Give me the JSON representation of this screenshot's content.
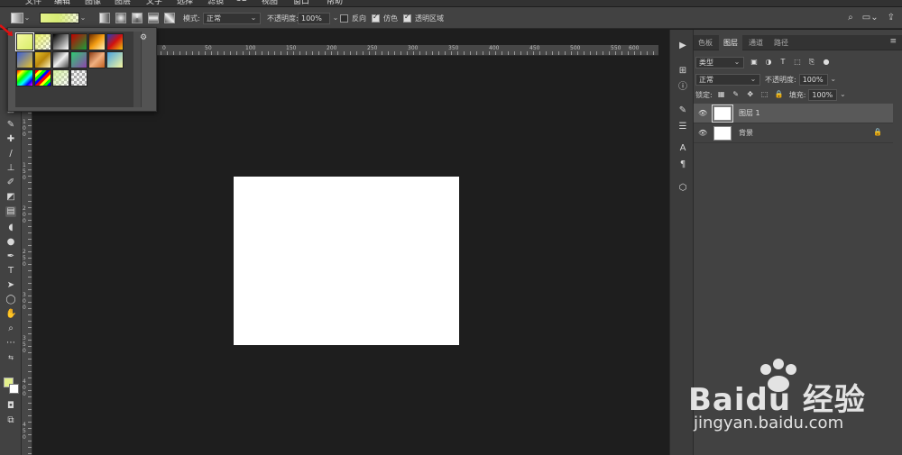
{
  "menubar": {
    "items": [
      "文件",
      "编辑",
      "图像",
      "图层",
      "文字",
      "选择",
      "滤镜",
      "3D",
      "视图",
      "窗口",
      "帮助"
    ]
  },
  "options": {
    "mode_label": "模式:",
    "mode_value": "正常",
    "opacity_label": "不透明度:",
    "opacity_value": "100%",
    "reverse_label": "反向",
    "dither_label": "仿色",
    "transparency_label": "透明区域"
  },
  "gradient_presets": [
    "#f0f58a",
    "#e8f060",
    "#000000",
    "#c00000",
    "#f39c12",
    "#1f3fbf",
    "#3a5fd9",
    "#e7c22a",
    "#c0c0c0",
    "#2ecc71",
    "#c06020",
    "#4aa3df",
    "#ff0000",
    "#e83e8c",
    "#d4f0a0",
    "#f2f2f2"
  ],
  "ruler": {
    "top_labels": [
      "0",
      "50",
      "100",
      "150",
      "200",
      "250",
      "300",
      "350",
      "400",
      "450",
      "500",
      "550",
      "600",
      "650",
      "700",
      "750"
    ],
    "left_labels": [
      "1",
      "0",
      "0",
      "1",
      "5",
      "0",
      "2",
      "0",
      "0",
      "2",
      "5",
      "0",
      "3",
      "0",
      "0",
      "3",
      "5",
      "0",
      "4",
      "0",
      "0",
      "4",
      "5",
      "0"
    ]
  },
  "panel": {
    "tabs": [
      "色板",
      "图层",
      "通道",
      "路径"
    ],
    "filter_label": "类型",
    "blend_mode": "正常",
    "opacity_label": "不透明度:",
    "opacity_value": "100%",
    "lock_label": "锁定:",
    "fill_label": "填充:",
    "fill_value": "100%",
    "layers": [
      {
        "name": "图层 1",
        "selected": true
      },
      {
        "name": "背景",
        "selected": false,
        "locked": true
      }
    ]
  },
  "watermark": {
    "main": "Baidu 经验",
    "sub": "jingyan.baidu.com"
  },
  "colors": {
    "foreground": "#e3f08c",
    "background": "#ffffff",
    "canvas": "#ffffff",
    "workspace": "#1e1e1e",
    "panel": "#424242"
  }
}
